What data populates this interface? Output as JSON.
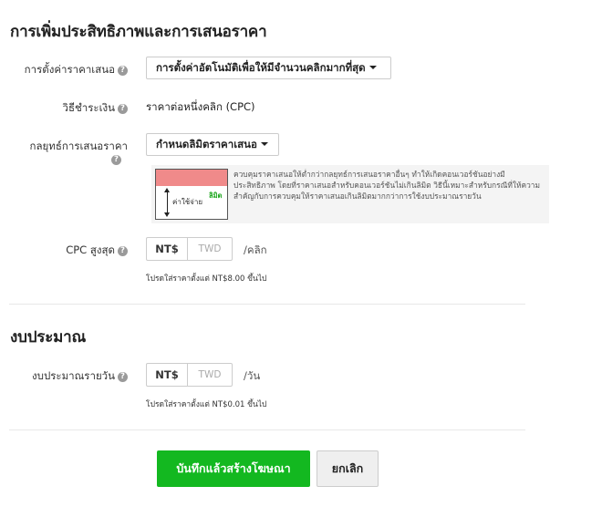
{
  "bidding_section": {
    "title": "การเพิ่มประสิทธิภาพและการเสนอราคา",
    "bid_setting": {
      "label": "การตั้งค่าราคาเสนอ",
      "value": "การตั้งค่าอัตโนมัติเพื่อให้มีจำนวนคลิกมากที่สุด"
    },
    "payment_method": {
      "label": "วิธีชำระเงิน",
      "value": "ราคาต่อหนึ่งคลิก (CPC)"
    },
    "bid_strategy": {
      "label": "กลยุทธ์การเสนอราคา",
      "value": "กำหนดลิมิตราคาเสนอ",
      "info": {
        "text": "ควบคุมราคาเสนอให้ต่ำกว่ากลยุทธ์การเสนอราคาอื่นๆ ทำให้เกิดคอนเวอร์ชันอย่างมีประสิทธิภาพ โดยที่ราคาเสนอสำหรับคอนเวอร์ชันไม่เกินลิมิต วิธีนี้เหมาะสำหรับกรณีที่ให้ความสำคัญกับการควบคุมให้ราคาเสนอเกินลิมิตมากกว่าการใช้งบประมาณรายวัน",
        "graphic_spend_label": "ค่าใช้จ่าย",
        "graphic_limit_label": "ลิมิต"
      }
    },
    "max_cpc": {
      "label": "CPC สูงสุด",
      "currency_active": "NT$",
      "currency_inactive": "TWD",
      "unit": "/คลิก",
      "hint": "โปรดใส่ราคาตั้งแต่ NT$8.00 ขึ้นไป"
    }
  },
  "budget_section": {
    "title": "งบประมาณ",
    "daily_budget": {
      "label": "งบประมาณรายวัน",
      "currency_active": "NT$",
      "currency_inactive": "TWD",
      "unit": "/วัน",
      "hint": "โปรดใส่ราคาตั้งแต่ NT$0.01 ขึ้นไป"
    }
  },
  "actions": {
    "save_label": "บันทึกแล้วสร้างโฆษณา",
    "cancel_label": "ยกเลิก"
  },
  "icons": {
    "help": "question-circle-icon",
    "dropdown": "caret-down-icon"
  },
  "colors": {
    "primary_button": "#13b820",
    "info_bar": "#f08a8a",
    "limit_text": "#1aa51a"
  }
}
